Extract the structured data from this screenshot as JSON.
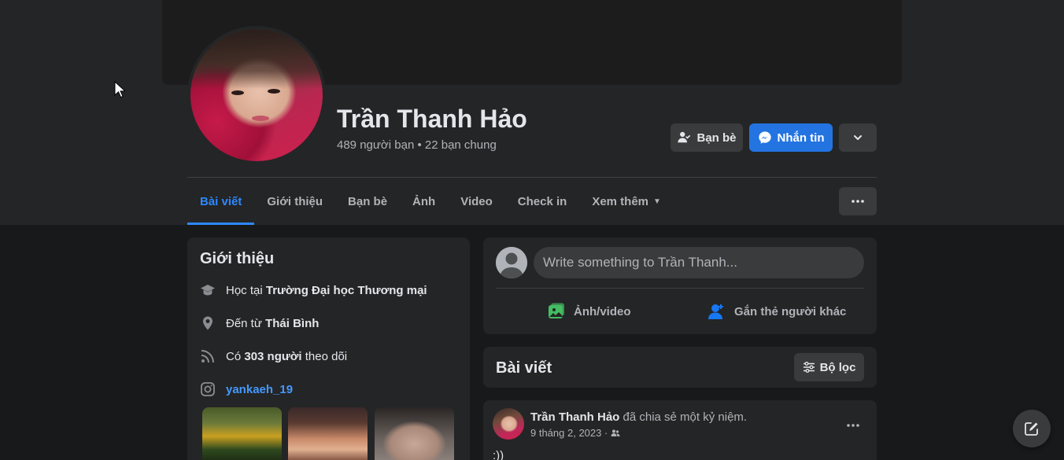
{
  "profile": {
    "name": "Trần Thanh Hảo",
    "friends_summary": "489 người bạn • 22 bạn chung"
  },
  "actions": {
    "friends_label": "Bạn bè",
    "message_label": "Nhắn tin"
  },
  "tabs": [
    {
      "label": "Bài viết",
      "active": true
    },
    {
      "label": "Giới thiệu"
    },
    {
      "label": "Bạn bè"
    },
    {
      "label": "Ảnh"
    },
    {
      "label": "Video"
    },
    {
      "label": "Check in"
    },
    {
      "label": "Xem thêm"
    }
  ],
  "intro": {
    "title": "Giới thiệu",
    "education_prefix": "Học tại",
    "education_school": "Trường Đại học Thương mại",
    "hometown_prefix": "Đến từ",
    "hometown_place": "Thái Bình",
    "followers_prefix": "Có",
    "followers_bold": "303 người",
    "followers_suffix": "theo dõi",
    "instagram": "yankaeh_19"
  },
  "composer": {
    "placeholder": "Write something to Trần Thanh...",
    "photo_video": "Ảnh/video",
    "tag_people": "Gắn thẻ người khác"
  },
  "posts": {
    "title": "Bài viết",
    "filter_label": "Bộ lọc"
  },
  "post": {
    "author": "Trần Thanh Hảo",
    "action": "đã chia sẻ một kỷ niệm.",
    "date": "9 tháng 2, 2023 ·",
    "text": ":))"
  },
  "colors": {
    "accent": "#2d88ff",
    "button_blue": "#2374e1",
    "background": "#18191a",
    "surface": "#242526"
  }
}
